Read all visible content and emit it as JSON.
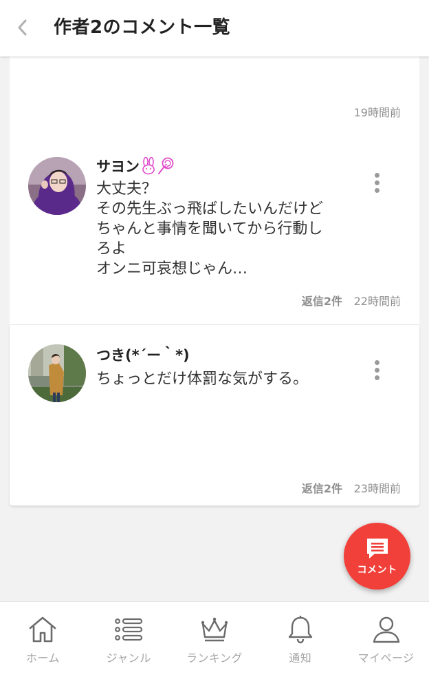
{
  "header": {
    "title": "作者2のコメント一覧"
  },
  "first_card": {
    "time": "19時間前"
  },
  "comments": [
    {
      "username": "サヨン",
      "username_icons": [
        "rabbit-icon",
        "lollipop-icon"
      ],
      "text": "大丈夫？\nその先生ぶっ飛ばしたいんだけど\nちゃんと事情を聞いてから行動し\nろよ\nオンニ可哀想じゃん…",
      "replies": "返信2件",
      "time": "22時間前"
    },
    {
      "username": "つき(*´ー｀*)",
      "text": "ちょっとだけ体罰な気がする。",
      "replies": "返信2件",
      "time": "23時間前"
    }
  ],
  "fab": {
    "label": "コメント",
    "color": "#f1403a"
  },
  "bottom_nav": [
    {
      "label": "ホーム",
      "icon": "home-icon"
    },
    {
      "label": "ジャンル",
      "icon": "list-icon"
    },
    {
      "label": "ランキング",
      "icon": "crown-icon"
    },
    {
      "label": "通知",
      "icon": "bell-icon"
    },
    {
      "label": "マイページ",
      "icon": "user-icon"
    }
  ]
}
